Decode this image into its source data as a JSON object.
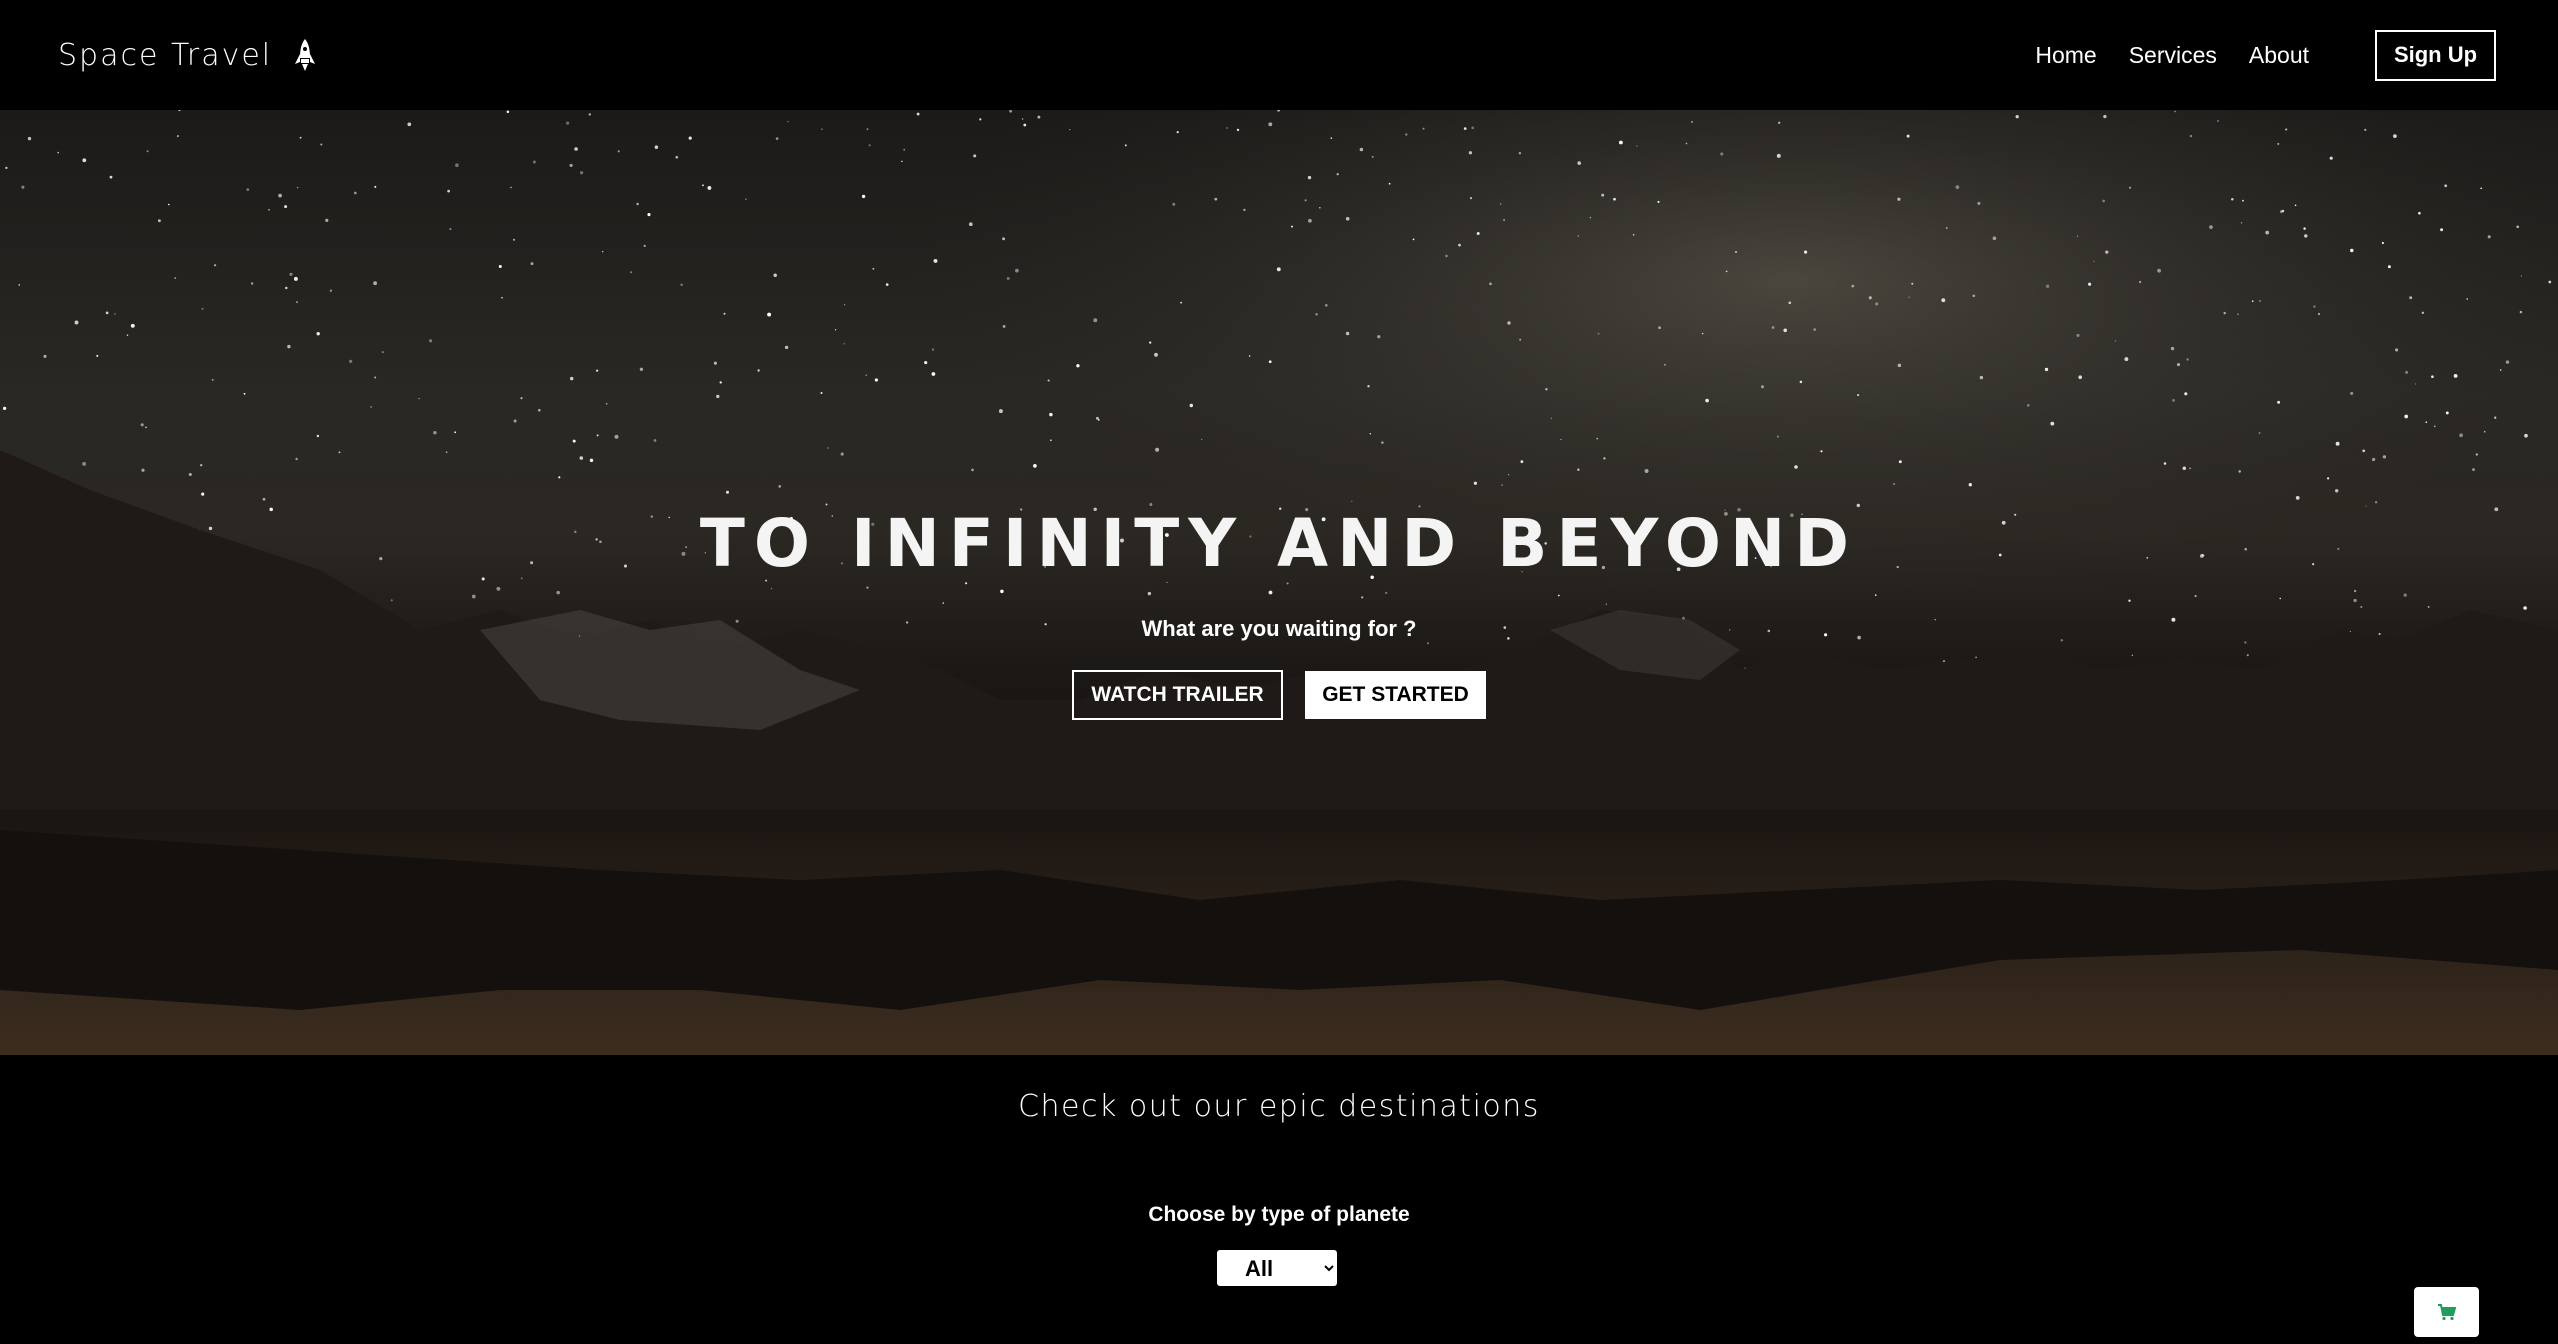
{
  "navbar": {
    "brand": "Space Travel",
    "brand_icon": "rocket-icon",
    "links": [
      "Home",
      "Services",
      "About"
    ],
    "signup_label": "Sign Up"
  },
  "hero": {
    "title": "TO INFINITY AND BEYOND",
    "subtitle": "What are you waiting for ?",
    "watch_trailer_label": "WATCH TRAILER",
    "get_started_label": "GET STARTED"
  },
  "destinations": {
    "title": "Check out our epic destinations",
    "filter_label": "Choose by type of planete",
    "filter_value": "All"
  },
  "cart": {
    "icon": "cart-icon",
    "accent_color": "#1e9e5a"
  }
}
